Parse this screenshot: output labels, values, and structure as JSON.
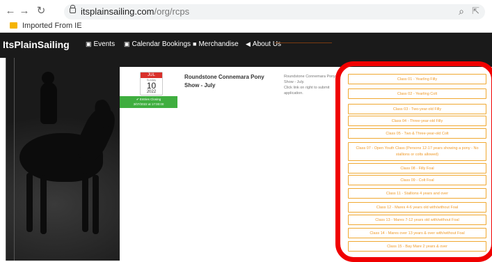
{
  "browser": {
    "url_domain": "itsplainsailing.com",
    "url_path": "/org/rcps",
    "bookmark": "Imported From IE"
  },
  "site": {
    "brand": "ItsPlainSailing",
    "nav": [
      "Events",
      "Calendar Bookings",
      "Merchandise",
      "About Us"
    ]
  },
  "event": {
    "cal_month": "JUL",
    "cal_weekday": "Sunday",
    "cal_day": "10",
    "cal_year": "2022",
    "closing_label": "Entries Closing",
    "closing_time": "3/07/2022 at 17:00:00",
    "title": "Roundstone Connemara Pony Show - July",
    "desc_1": "Roundstone Connemara Pony Show - July.",
    "desc_2": "Click link on right to submit application."
  },
  "classes": [
    "Class 01 - Yearling Filly",
    "Class 02 - Yearling Colt",
    "Class 03 - Two-year-old Filly",
    "Class 04 - Three-year-old Filly",
    "Class 05 - Two & Three-year-old Colt",
    "Class 07 - Open Youth Class (Persons 12-17 years showing a pony - No stallions or colts allowed)",
    "Class 08 - Filly Foal",
    "Class 09 - Colt Foal",
    "Class 11 - Stallions 4 years and over",
    "Class 12 - Mares 4-6 years old with/without Foal",
    "Class 13 - Mares 7-12 years old with/without Foal",
    "Class 14 - Mares over 13 years & over with/without Foal",
    "Class 15 - Bay Mare 2 years & over"
  ]
}
